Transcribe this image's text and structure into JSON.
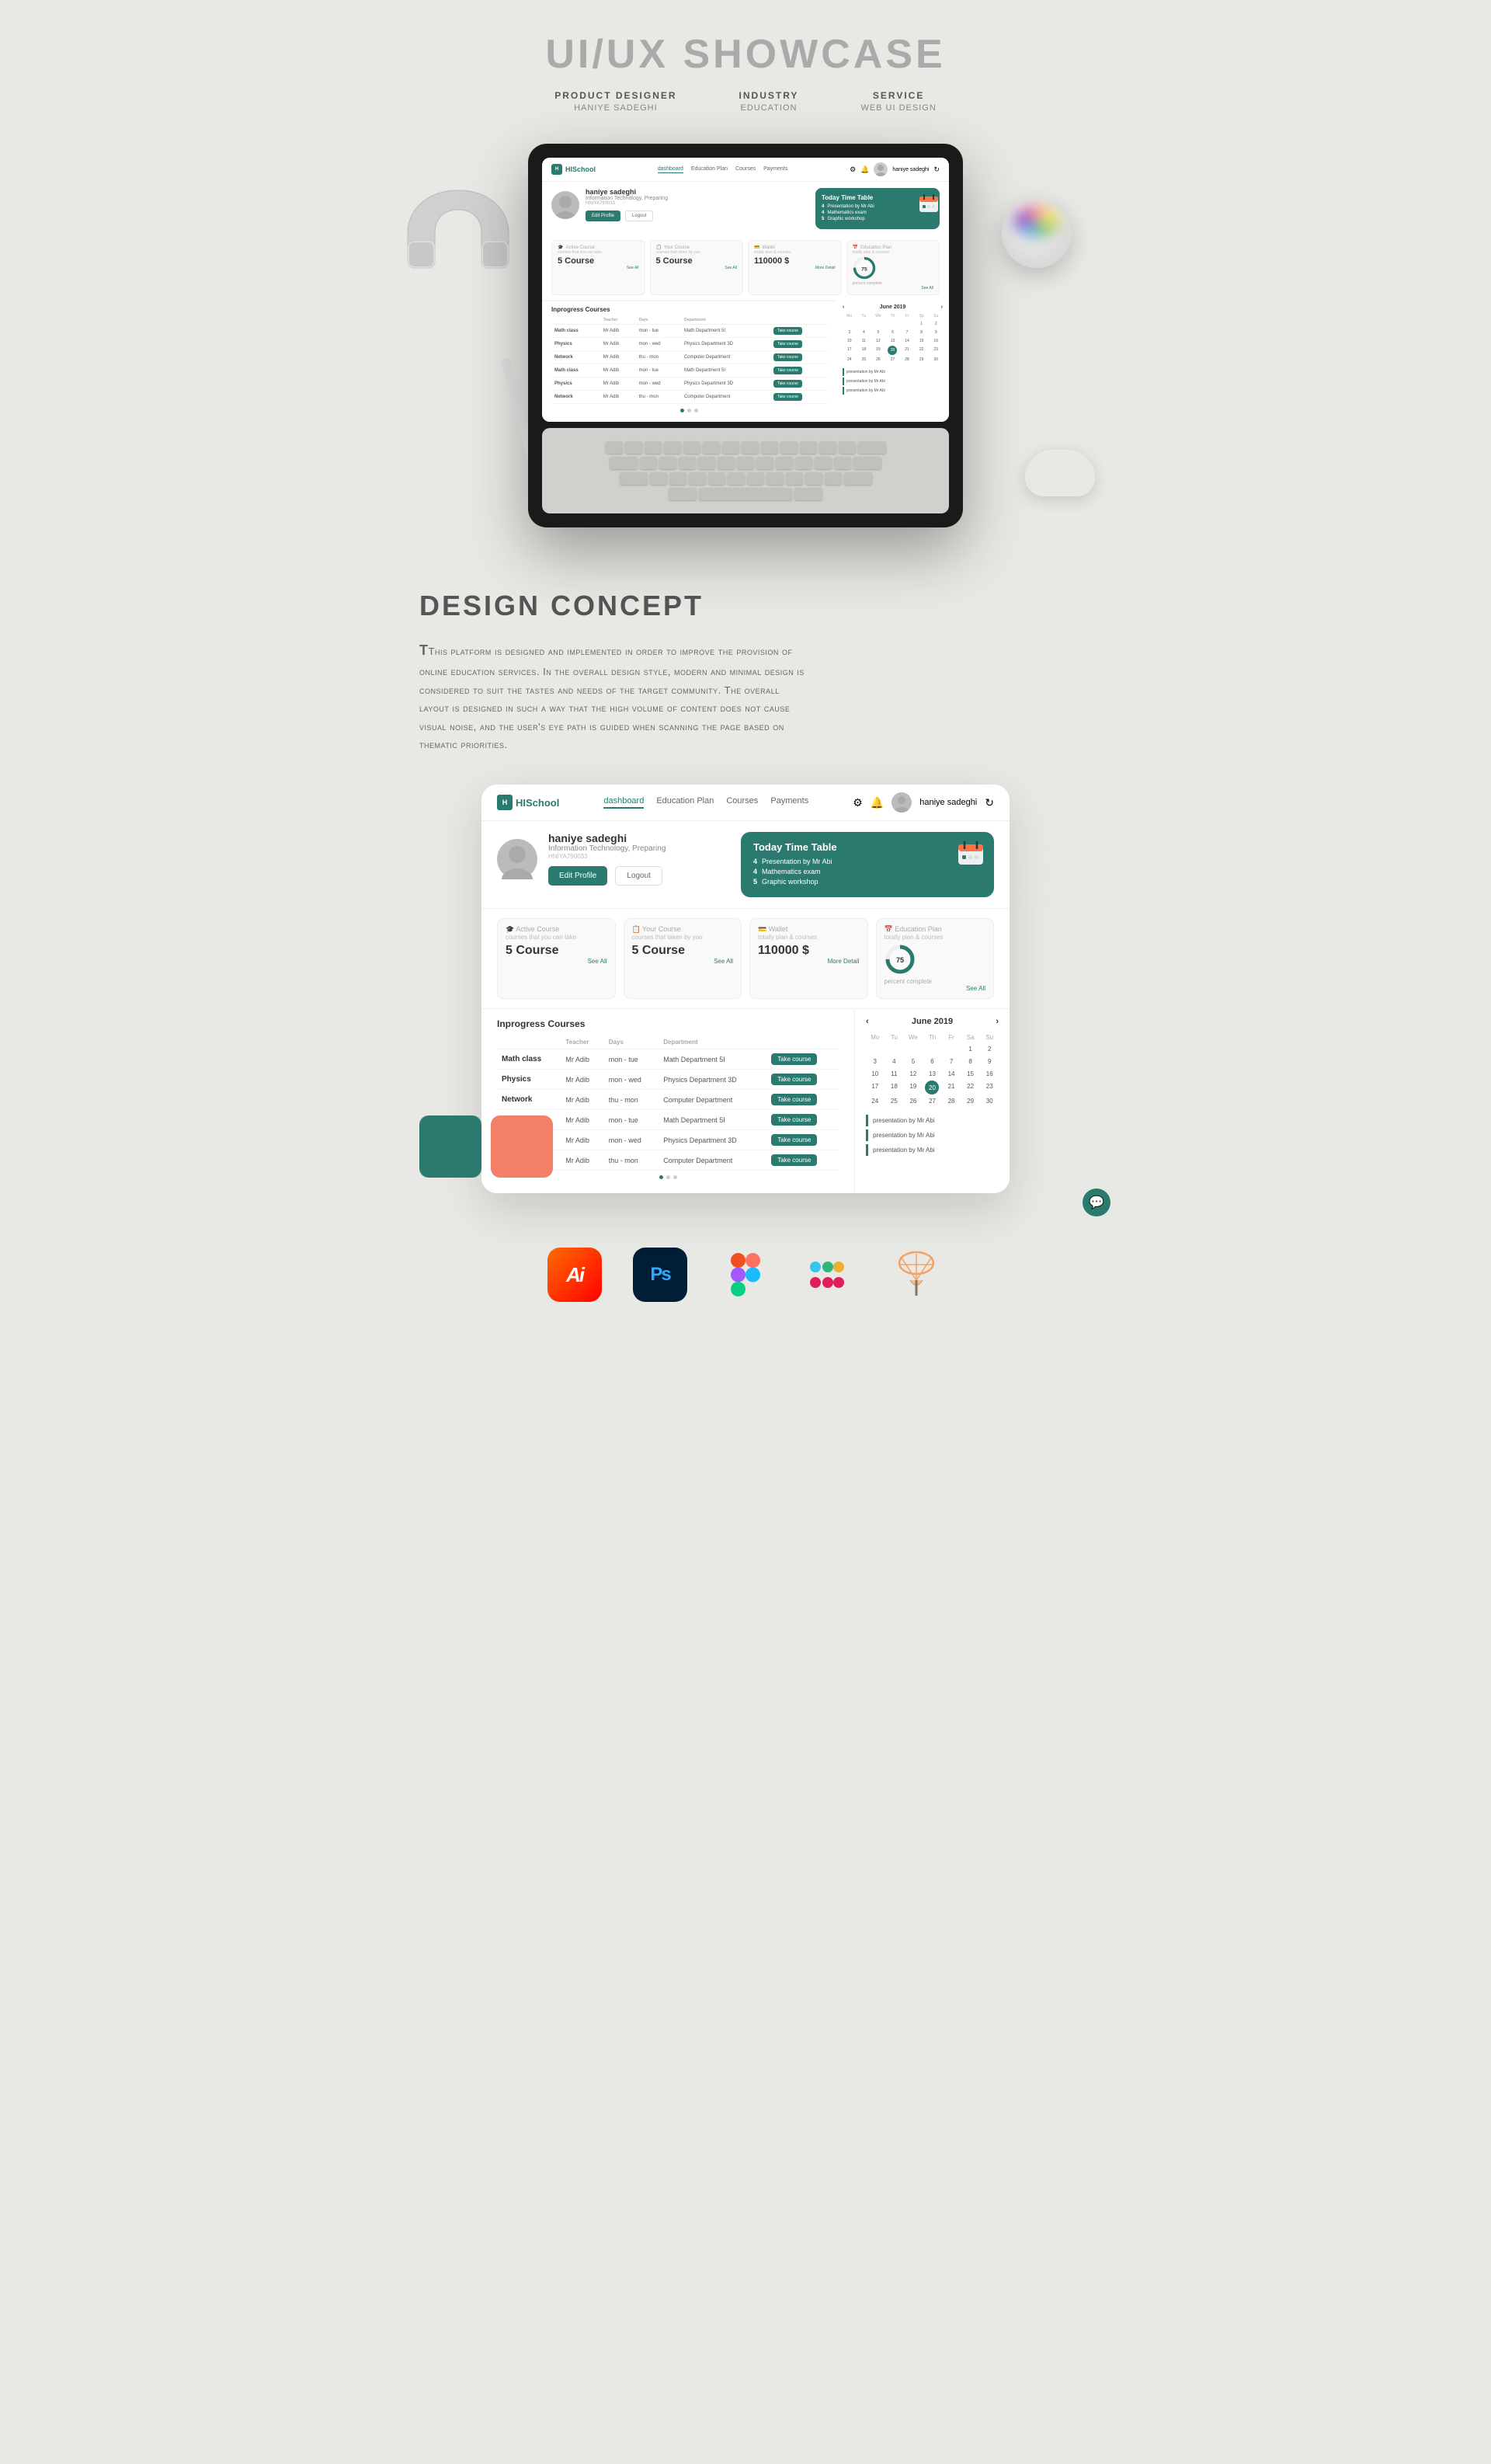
{
  "header": {
    "main_title": "UI/UX SHOWCASE",
    "meta": [
      {
        "label": "PRODUCT DESIGNER",
        "value": "HANIYE SADEGHI"
      },
      {
        "label": "INDUSTRY",
        "value": "EDUCATION"
      },
      {
        "label": "SERVICE",
        "value": "WEB UI DESIGN"
      }
    ]
  },
  "app": {
    "logo": "HISchool",
    "nav_links": [
      "dashboard",
      "Education Plan",
      "Courses",
      "Payments"
    ],
    "active_nav": "dashboard",
    "user_name": "haniye sadeghi",
    "user_role": "Information Technology, Preparing",
    "user_id": "HNIYA790033",
    "btn_edit": "Edit Profile",
    "btn_logout": "Logout",
    "timetable": {
      "title": "Today Time Table",
      "items": [
        {
          "num": "4",
          "text": "Presentation by Mr Abi"
        },
        {
          "num": "4",
          "text": "Mathematics exam"
        },
        {
          "num": "5",
          "text": "Graphic workshop"
        }
      ]
    },
    "stats": [
      {
        "title": "Active Course",
        "subtitle": "courses that you can take",
        "value": "5 Course",
        "see_all": "See All"
      },
      {
        "title": "Your Course",
        "subtitle": "courses that taken by you",
        "value": "5 Course",
        "see_all": "See All"
      },
      {
        "title": "Wallet",
        "subtitle": "totally plan & courses",
        "value": "110000 $",
        "see_all": "More Detail"
      },
      {
        "title": "Education Plan",
        "subtitle": "totally plan & courses",
        "value": "75",
        "unit": "percent complete",
        "see_all": "See All"
      }
    ],
    "courses": {
      "section_title": "Inprogress Courses",
      "headers": [
        "",
        "Teacher",
        "Days",
        "Department",
        ""
      ],
      "rows": [
        {
          "name": "Math class",
          "teacher": "Mr Adib",
          "days": "mon - tue",
          "department": "Math Department 5I",
          "action": "Take course"
        },
        {
          "name": "Physics",
          "teacher": "Mr Adib",
          "days": "mon - wed",
          "department": "Physics Department 3D",
          "action": "Take course"
        },
        {
          "name": "Network",
          "teacher": "Mr Adib",
          "days": "thu - mon",
          "department": "Computer Department",
          "action": "Take course"
        },
        {
          "name": "Math class",
          "teacher": "Mr Adib",
          "days": "mon - tue",
          "department": "Math Department 5I",
          "action": "Take course"
        },
        {
          "name": "Physics",
          "teacher": "Mr Adib",
          "days": "mon - wed",
          "department": "Physics Department 3D",
          "action": "Take course"
        },
        {
          "name": "Network",
          "teacher": "Mr Adib",
          "days": "thu - mon",
          "department": "Computer Department",
          "action": "Take course"
        }
      ]
    },
    "calendar": {
      "title": "June 2019",
      "day_headers": [
        "Mon",
        "Tue",
        "Wed",
        "Thu",
        "Fri",
        "Sat",
        "Sun"
      ],
      "days": [
        "",
        "",
        "",
        "",
        "",
        "1",
        "2",
        "3",
        "4",
        "5",
        "6",
        "7",
        "8",
        "9",
        "10",
        "11",
        "12",
        "13",
        "14",
        "15",
        "16",
        "17",
        "18",
        "19",
        "20",
        "21",
        "22",
        "23",
        "24",
        "25",
        "26",
        "27",
        "28",
        "29",
        "30"
      ],
      "today": "20",
      "events": [
        "presentation by Mr Abi",
        "presentation by Mr Abi",
        "presentation by Mr Abi"
      ]
    }
  },
  "design_concept": {
    "title": "DESIGN CONCEPT",
    "body": "This platform is designed and implemented in order to improve the provision of online education services. In the overall design style, modern and minimal design is considered to suit the tastes and needs of the target community. The overall layout is designed in such a way that the high volume of content does not cause visual noise, and the user's eye path is guided when scanning the page based on thematic priorities."
  },
  "colors": {
    "teal": "#2a7a6f",
    "salmon": "#f4806a",
    "bg": "#e8e8e4"
  },
  "tools": [
    {
      "name": "Adobe Illustrator",
      "label": "Ai",
      "icon_type": "ai"
    },
    {
      "name": "Adobe Photoshop",
      "label": "Ps",
      "icon_type": "ps"
    },
    {
      "name": "Figma",
      "label": "Figma",
      "icon_type": "figma"
    },
    {
      "name": "Slack",
      "label": "Slack",
      "icon_type": "slack"
    },
    {
      "name": "Other",
      "label": "",
      "icon_type": "other"
    }
  ]
}
